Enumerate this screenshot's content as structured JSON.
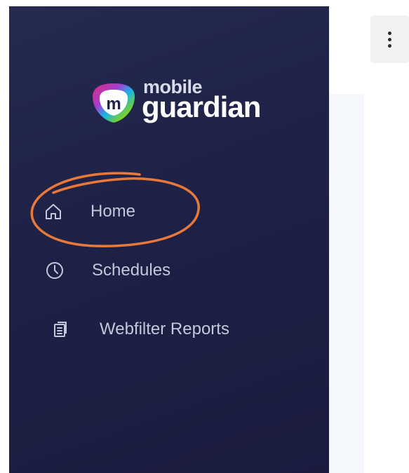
{
  "brand": {
    "name_line1": "mobile",
    "name_line2": "guardian",
    "mark_letter": "m",
    "colors": {
      "magenta": "#e0287c",
      "cyan": "#18b4e6",
      "green": "#7ed321",
      "yellow": "#f2c31a"
    }
  },
  "sidebar": {
    "background": "#1e2146",
    "items": [
      {
        "label": "Home",
        "icon": "home-icon",
        "highlighted": true
      },
      {
        "label": "Schedules",
        "icon": "clock-icon"
      },
      {
        "label": "Webfilter Reports",
        "icon": "report-icon"
      }
    ]
  },
  "header": {
    "menu_icon": "more-vertical-icon"
  },
  "annotation": {
    "shape": "hand-drawn-circle",
    "color": "#e8793a",
    "target": "Home"
  }
}
